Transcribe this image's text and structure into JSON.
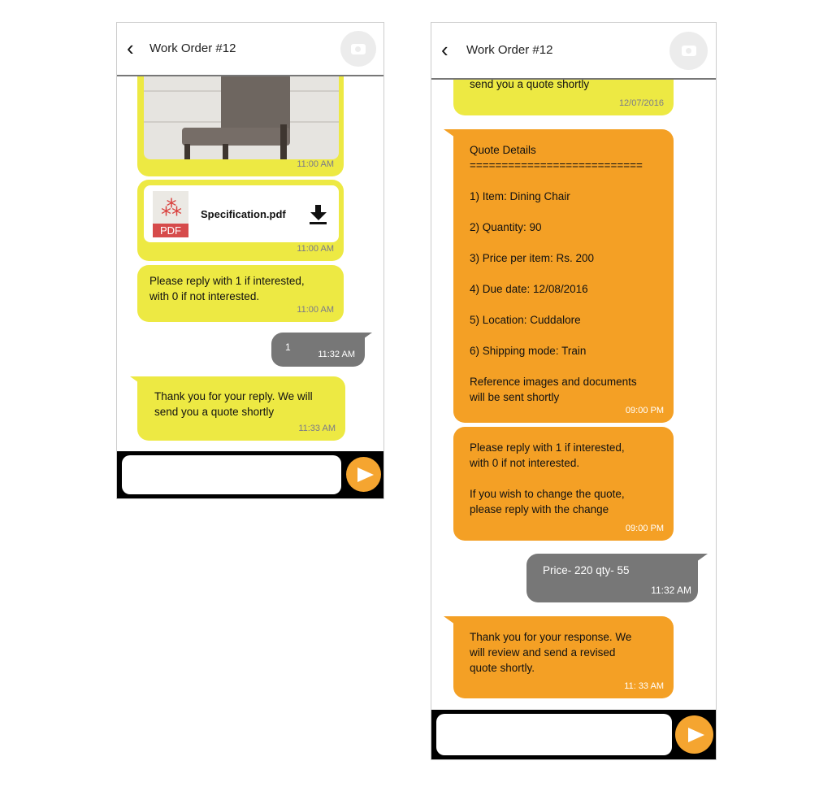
{
  "left": {
    "header": {
      "title": "Work Order #12"
    },
    "messages": [
      {
        "type": "image",
        "time": "11:00 AM"
      },
      {
        "type": "file",
        "filename": "Specification.pdf",
        "file_badge": "PDF",
        "time": "11:00 AM"
      },
      {
        "text": "Please reply with 1 if interested,\nwith 0 if not interested.",
        "time": "11:00 AM"
      },
      {
        "text": "1",
        "time": "11:32 AM"
      },
      {
        "text": "Thank you for your reply. We will\nsend you a quote shortly",
        "time": "11:33 AM"
      }
    ]
  },
  "right": {
    "header": {
      "title": "Work Order #12"
    },
    "messages": [
      {
        "text": "send you a quote shortly",
        "time": "12/07/2016"
      },
      {
        "text": "Quote Details\n===========================\n\n1) Item:  Dining Chair\n\n2) Quantity:  90\n\n3) Price per item: Rs. 200\n\n4) Due date: 12/08/2016\n\n5) Location: Cuddalore\n\n6) Shipping mode: Train\n\nReference images and documents\nwill be sent shortly",
        "time": "09:00 PM"
      },
      {
        "text": "Please reply with 1 if interested,\nwith 0 if not interested.\n\nIf you wish to change the quote,\nplease reply with the change",
        "time": "09:00 PM"
      },
      {
        "text": "Price- 220 qty- 55",
        "time": "11:32 AM"
      },
      {
        "text": "Thank you for your response. We\nwill review and send a revised\nquote shortly.",
        "time": "11: 33 AM"
      }
    ]
  },
  "colors": {
    "yellow": "#ede943",
    "orange": "#f4a025",
    "grey": "#777777",
    "send": "#f5a530"
  }
}
